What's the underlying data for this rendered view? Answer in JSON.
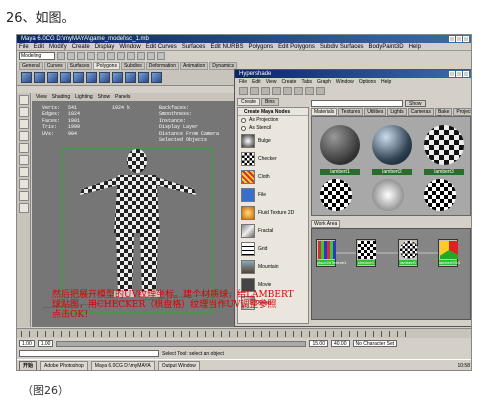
{
  "caption_top": "26、如图。",
  "caption_bottom": "（图26）",
  "maya": {
    "title": "Maya 6.0CG D:\\myMAYA\\game_model\\sc_1.mb",
    "menu": [
      "File",
      "Edit",
      "Modify",
      "Create",
      "Display",
      "Window",
      "Edit Curves",
      "Surfaces",
      "Edit NURBS",
      "Polygons",
      "Edit Polygons",
      "Subdiv Surfaces",
      "BodyPaint3D",
      "Help"
    ],
    "mode": "Modeling",
    "shelf_tabs": [
      "General",
      "Curves",
      "Surfaces",
      "Polygons",
      "Subdivs",
      "Deformation",
      "Animation",
      "Dynamics",
      "Rendering",
      "PaintEffects",
      "Cloth",
      "Fluids",
      "Fur",
      "Custom"
    ],
    "active_shelf_tab": "Polygons",
    "viewport_menu": [
      "View",
      "Shading",
      "Lighting",
      "Show",
      "Panels"
    ],
    "hud_labels": [
      "Verts:",
      "Edges:",
      "Faces:",
      "Tris:",
      "UVs:"
    ],
    "hud_vals_a": [
      "541",
      "1024",
      "1001",
      "1999",
      "904"
    ],
    "hud_vals_b": [
      "1024 k",
      "",
      "",
      "",
      ""
    ],
    "hud_right": [
      "Backfaces:",
      "Smoothness:",
      "Instance:",
      "Display Layer",
      "Distance From Camera",
      "Selected Objects"
    ],
    "overlay_lines": [
      "然后把展开模型的UV纹理坐标。建个材质球，给LAMBERT",
      "球贴图，用CHECKER（棋盘格）纹理当作UV调整参照",
      "点击OK！"
    ],
    "frame_start": "1.00",
    "frame_cur": "1.00",
    "range_end": "15.00",
    "range_end2": "40.00",
    "character_set": "No Character Set",
    "cmd_hint": "Select Tool: select an object"
  },
  "hypershade": {
    "title": "Hypershade",
    "menu": [
      "File",
      "Edit",
      "View",
      "Create",
      "Tabs",
      "Graph",
      "Window",
      "Options",
      "Help"
    ],
    "left_tabs": [
      "Create",
      "Bins"
    ],
    "create_header": "Create Maya Nodes",
    "projection_items": [
      "As Projection",
      "As Stencil"
    ],
    "node_items": [
      "Bulge",
      "Checker",
      "Cloth",
      "File",
      "Fluid Texture 2D",
      "Fractal",
      "Grid",
      "Mountain",
      "Movie",
      "Noise"
    ],
    "show_button": "Show",
    "right_tabs": [
      "Materials",
      "Textures",
      "Utilities",
      "Lights",
      "Cameras",
      "Bake Sets",
      "Projects"
    ],
    "materials": [
      "lambert1",
      "lambert2",
      "lambert3"
    ],
    "work_area_label": "Work Area",
    "work_nodes": [
      "place2dTexture1",
      "checker1",
      "lambert3",
      "lambert3SG"
    ]
  },
  "taskbar": {
    "start_label": "开始",
    "items": [
      "Adobe Photoshop",
      "Maya 6.0CG D:\\myMAYA",
      "Output Window"
    ],
    "clock": "10:58"
  }
}
